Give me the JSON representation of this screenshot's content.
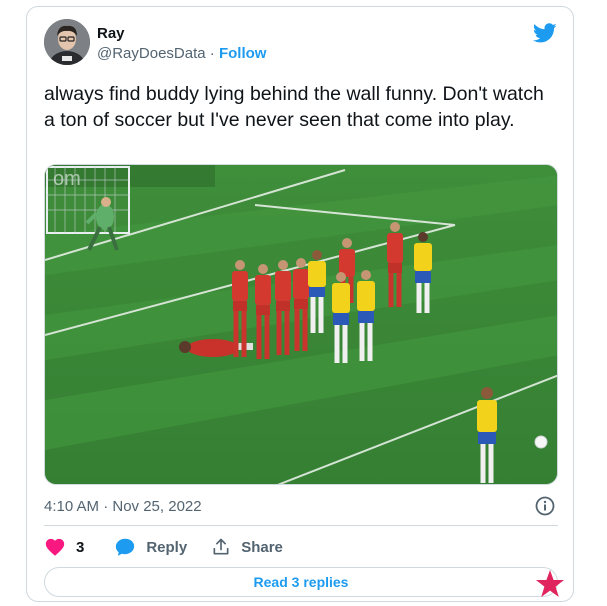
{
  "tweet": {
    "author_name": "Ray",
    "handle": "@RayDoesData",
    "separator": " · ",
    "follow_label": "Follow",
    "text": "always find buddy lying behind the wall funny. Don't watch a ton of soccer but I've never seen that come into play.",
    "timestamp": "4:10 AM · Nov 25, 2022",
    "like_count": "3",
    "reply_label": "Reply",
    "share_label": "Share",
    "read_replies_label": "Read 3 replies"
  },
  "icons": {
    "brand": "twitter-bird-icon",
    "info": "info-icon",
    "like": "heart-icon",
    "reply": "reply-bubble-icon",
    "share": "share-icon",
    "corner": "star-icon"
  },
  "colors": {
    "accent": "#1d9bf0",
    "like": "#f91880",
    "text_secondary": "#536471",
    "border": "#cfd9de",
    "star": "#e0245e"
  }
}
